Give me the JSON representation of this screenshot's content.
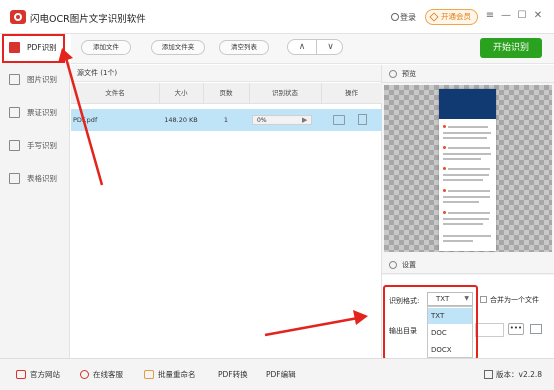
{
  "app": {
    "title": "闪电OCR图片文字识别软件",
    "login": "登录",
    "vip": "开通会员",
    "window_controls": [
      "≡",
      "—",
      "☐",
      "✕"
    ]
  },
  "sidebar": {
    "items": [
      {
        "label": "PDF识别",
        "icon": "pdf-icon",
        "active": true
      },
      {
        "label": "图片识别",
        "icon": "image-icon",
        "active": false
      },
      {
        "label": "票证识别",
        "icon": "ticket-icon",
        "active": false
      },
      {
        "label": "手写识别",
        "icon": "handwriting-icon",
        "active": false
      },
      {
        "label": "表格识别",
        "icon": "table-icon",
        "active": false
      }
    ]
  },
  "toolbar": {
    "add_file": "添加文件",
    "add_folder": "添加文件夹",
    "clear_list": "清空列表",
    "up": "∧",
    "down": "∨",
    "start": "开始识别"
  },
  "files": {
    "header": "源文件 (1个)",
    "columns": [
      "文件名",
      "大小",
      "页数",
      "识别状态",
      "操作"
    ],
    "rows": [
      {
        "name": "PDF.pdf",
        "size": "148.20 KB",
        "pages": "1",
        "status": "0%"
      }
    ]
  },
  "preview": {
    "title": "预览"
  },
  "settings": {
    "title": "设置",
    "format_label": "识别格式:",
    "format_value": "TXT",
    "merge_label": "合并为一个文件",
    "output_label": "输出目录",
    "options": [
      "TXT",
      "DOC",
      "DOCX"
    ],
    "dots": "•••"
  },
  "footer": {
    "website": "官方网站",
    "support": "在线客服",
    "rename": "批量重命名",
    "pdf_convert": "PDF转换",
    "pdf_edit": "PDF编辑",
    "version": "版本：v2.2.8"
  },
  "colors": {
    "accent_red": "#d8332c",
    "start_green": "#2aa11f",
    "highlight": "#e3231c",
    "row_select": "#bfe4f8"
  }
}
